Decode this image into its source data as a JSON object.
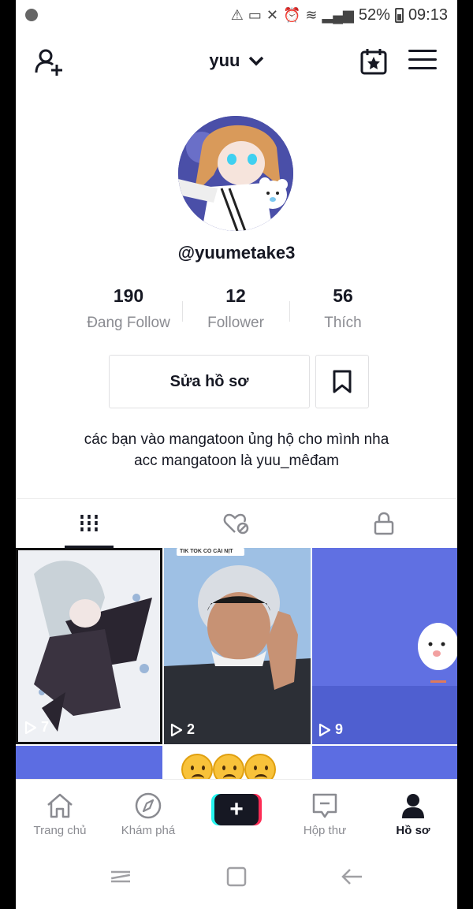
{
  "status_bar": {
    "battery": "52%",
    "time": "09:13",
    "icons": [
      "warning-icon",
      "cast-icon",
      "mute-icon",
      "alarm-icon",
      "wifi-icon",
      "signal-icon",
      "battery-icon"
    ]
  },
  "header": {
    "title": "yuu",
    "icons": [
      "add-user-icon",
      "chevron-down-icon",
      "calendar-star-icon",
      "menu-icon"
    ]
  },
  "profile": {
    "username": "@yuumetake3",
    "stats": [
      {
        "value": "190",
        "label": "Đang Follow"
      },
      {
        "value": "12",
        "label": "Follower"
      },
      {
        "value": "56",
        "label": "Thích"
      }
    ],
    "edit_button": "Sửa hồ sơ",
    "bio_line1": "các bạn vào mangatoon ủng hộ cho mình nha",
    "bio_line2": "acc mangatoon là yuu_mêđam"
  },
  "tabs": [
    {
      "icon": "grid-icon",
      "active": true
    },
    {
      "icon": "liked-hidden-icon",
      "active": false
    },
    {
      "icon": "lock-icon",
      "active": false
    }
  ],
  "videos": [
    {
      "views": "7"
    },
    {
      "views": "2",
      "banner": "TIK TOK CÓ CÁI NỊT"
    },
    {
      "views": "9"
    }
  ],
  "bottom_nav": [
    {
      "label": "Trang chủ",
      "icon": "home-icon"
    },
    {
      "label": "Khám phá",
      "icon": "compass-icon"
    },
    {
      "label": "",
      "icon": "plus-icon"
    },
    {
      "label": "Hộp thư",
      "icon": "inbox-icon"
    },
    {
      "label": "Hồ sơ",
      "icon": "profile-icon",
      "active": true
    }
  ],
  "colors": {
    "text": "#161823",
    "muted": "#8a8b91",
    "tiktok_cyan": "#25f4ee",
    "tiktok_red": "#fe2c55",
    "video_bg_blue": "#5e6fe0"
  }
}
